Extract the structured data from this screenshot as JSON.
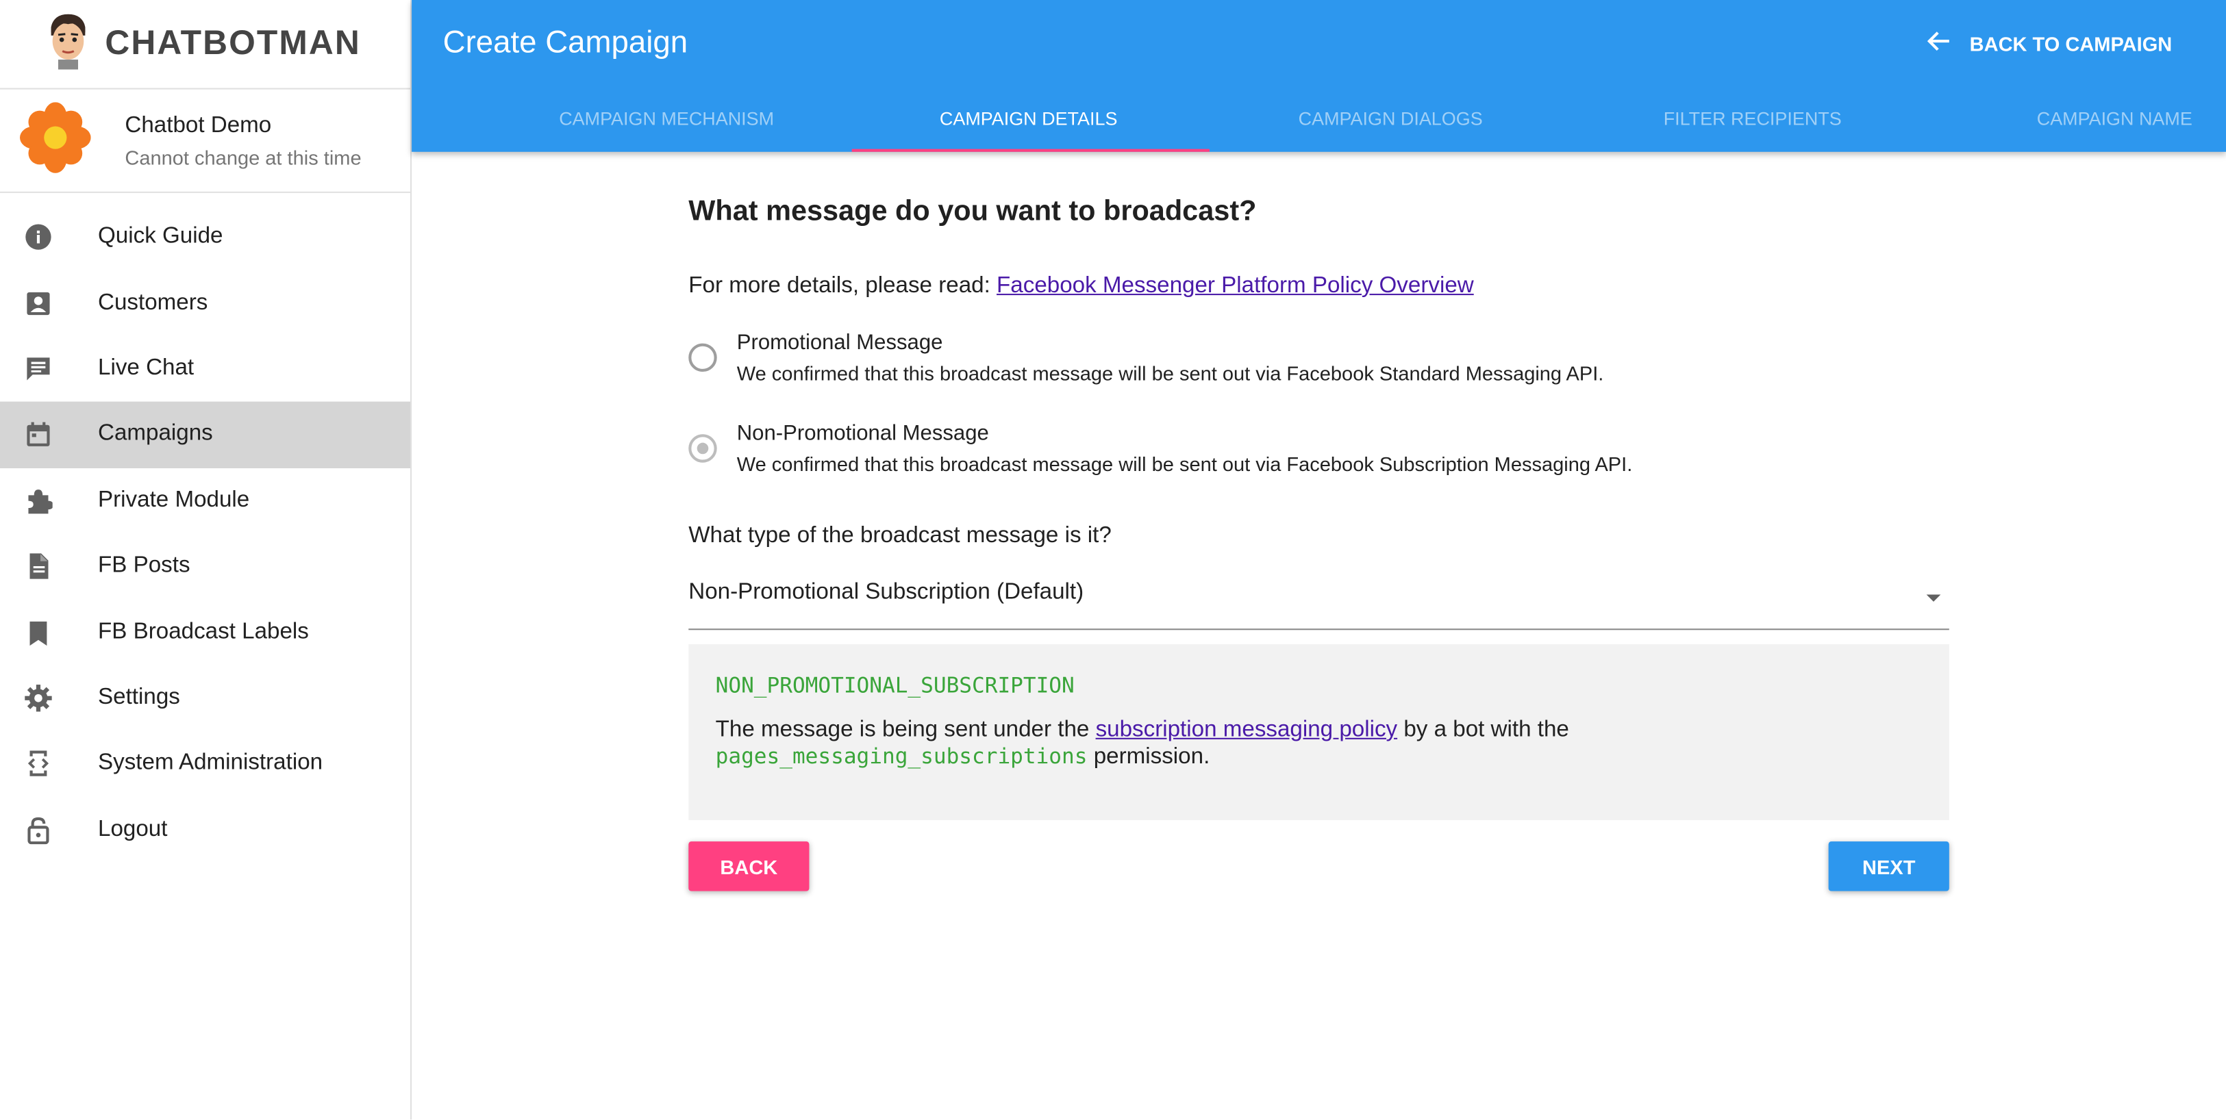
{
  "brand": {
    "name": "CHATBOTMAN"
  },
  "account": {
    "name": "Chatbot Demo",
    "note": "Cannot change at this time"
  },
  "sidebar": {
    "items": [
      {
        "label": "Quick Guide",
        "icon": "info-icon"
      },
      {
        "label": "Customers",
        "icon": "contact-card-icon"
      },
      {
        "label": "Live Chat",
        "icon": "chat-icon"
      },
      {
        "label": "Campaigns",
        "icon": "calendar-icon",
        "active": true
      },
      {
        "label": "Private Module",
        "icon": "puzzle-icon"
      },
      {
        "label": "FB Posts",
        "icon": "document-icon"
      },
      {
        "label": "FB Broadcast Labels",
        "icon": "bookmark-icon"
      },
      {
        "label": "Settings",
        "icon": "gear-icon"
      },
      {
        "label": "System Administration",
        "icon": "developer-mode-icon"
      },
      {
        "label": "Logout",
        "icon": "lock-open-icon"
      }
    ]
  },
  "header": {
    "title": "Create Campaign",
    "back_label": "BACK TO CAMPAIGN",
    "tabs": [
      "CAMPAIGN MECHANISM",
      "CAMPAIGN DETAILS",
      "CAMPAIGN DIALOGS",
      "FILTER RECIPIENTS",
      "CAMPAIGN NAME"
    ],
    "active_tab": "CAMPAIGN DETAILS"
  },
  "main": {
    "question": "What message do you want to broadcast?",
    "details_prefix": "For more details, please read:",
    "details_link": "Facebook Messenger Platform Policy Overview",
    "options": [
      {
        "title": "Promotional Message",
        "desc": "We confirmed that this broadcast message will be sent out via Facebook Standard Messaging API.",
        "checked": false
      },
      {
        "title": "Non-Promotional Message",
        "desc": "We confirmed that this broadcast message will be sent out via Facebook Subscription Messaging API.",
        "checked": true
      }
    ],
    "type_question": "What type of the broadcast message is it?",
    "type_value": "Non-Promotional Subscription (Default)",
    "info": {
      "code_title": "NON_PROMOTIONAL_SUBSCRIPTION",
      "text_1": "The message is being sent under the",
      "link": "subscription messaging policy",
      "text_2": "by a bot with the",
      "code": "pages_messaging_subscriptions",
      "text_3": "permission."
    },
    "back_button": "BACK",
    "next_button": "NEXT"
  },
  "colors": {
    "primary": "#2d97ee",
    "accent": "#ff4081",
    "code": "#3aa53a",
    "link": "#4a1aa8"
  }
}
